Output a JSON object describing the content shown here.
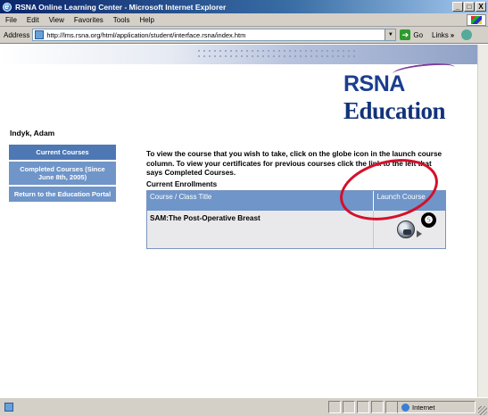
{
  "window": {
    "title": "RSNA Online Learning Center - Microsoft Internet Explorer",
    "minimize": "_",
    "maximize": "□",
    "close": "X"
  },
  "menubar": {
    "items": [
      "File",
      "Edit",
      "View",
      "Favorites",
      "Tools",
      "Help"
    ]
  },
  "addressbar": {
    "label": "Address",
    "url": "http://lms.rsna.org/html/application/student/interface.rsna/index.htm",
    "go_label": "Go",
    "links_label": "Links",
    "links_arrow": "»"
  },
  "page": {
    "logo_rsna": "RSNA",
    "logo_education": "Education",
    "user_name": "Indyk, Adam",
    "sidebar": {
      "items": [
        {
          "label": "Current Courses"
        },
        {
          "label": "Completed Courses (Since June 8th, 2005)"
        },
        {
          "label": "Return to the Education Portal"
        }
      ]
    },
    "instructions": "To view the course that you wish to take, click on the globe icon in the launch course column. To view your certificates for previous courses click the link to the left that says Completed Courses.",
    "enrollments_title": "Current Enrollments",
    "table": {
      "headers": [
        "Course / Class Title",
        "Launch Course"
      ],
      "rows": [
        {
          "title": "SAM:The Post-Operative Breast"
        }
      ]
    },
    "callout_number": "❺"
  },
  "statusbar": {
    "zone": "Internet"
  },
  "colors": {
    "sidebar_bg": "#6f95c9",
    "table_header_bg": "#6f95c9",
    "highlight_oval": "#d4102a",
    "logo_blue": "#1a3e8f"
  }
}
